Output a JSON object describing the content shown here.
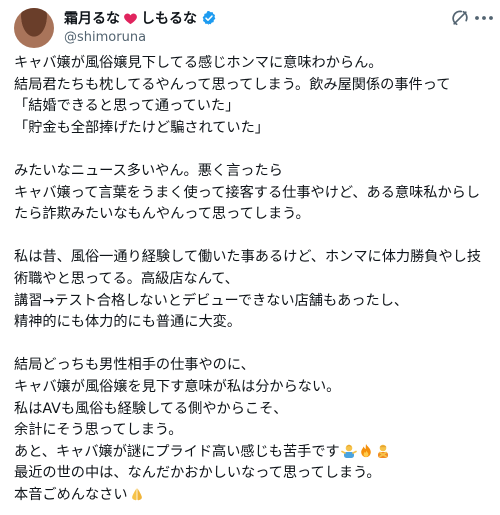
{
  "author": {
    "display_name_part1": "霜月るな",
    "display_name_part2": "しもるな",
    "handle": "@shimoruna",
    "verified": true
  },
  "icons": {
    "heart": "red-heart-icon",
    "verified": "verified-badge-icon",
    "grok": "grok-icon",
    "more": "more-options-icon"
  },
  "colors": {
    "verified_blue": "#1d9bf0",
    "heart_red": "#e0245e",
    "text": "#0f1419",
    "secondary": "#536471"
  },
  "post": {
    "lines": [
      "キャバ嬢が風俗嬢見下してる感じホンマに意味わからん。",
      "結局君たちも枕してるやんって思ってしまう。飲み屋関係の事件って",
      "「結婚できると思って通っていた」",
      "「貯金も全部捧げたけど騙されていた」",
      "",
      "みたいなニュース多いやん。悪く言ったら",
      "キャバ嬢って言葉をうまく使って接客する仕事やけど、ある意味私からし",
      "たら詐欺みたいなもんやんって思ってしまう。",
      "",
      "私は昔、風俗一通り経験して働いた事あるけど、ホンマに体力勝負やし技",
      "術職やと思ってる。高級店なんて、",
      "講習→テスト合格しないとデビューできない店舗もあったし、",
      "精神的にも体力的にも普通に大変。",
      "",
      "結局どっちも男性相手の仕事やのに、",
      "キャバ嬢が風俗嬢を見下す意味が私は分からない。",
      "私はAVも風俗も経験してる側やからこそ、",
      "余計にそう思ってしまう。",
      "あと、キャバ嬢が謎にプライド高い感じも苦手です",
      "最近の世の中は、なんだかおかしいなって思ってしまう。",
      "本音ごめんなさい"
    ],
    "line19_emojis": [
      "person-shrugging-emoji",
      "fire-emoji",
      "person-gesturing-no-emoji"
    ],
    "line21_emoji": "folded-hands-emoji"
  }
}
